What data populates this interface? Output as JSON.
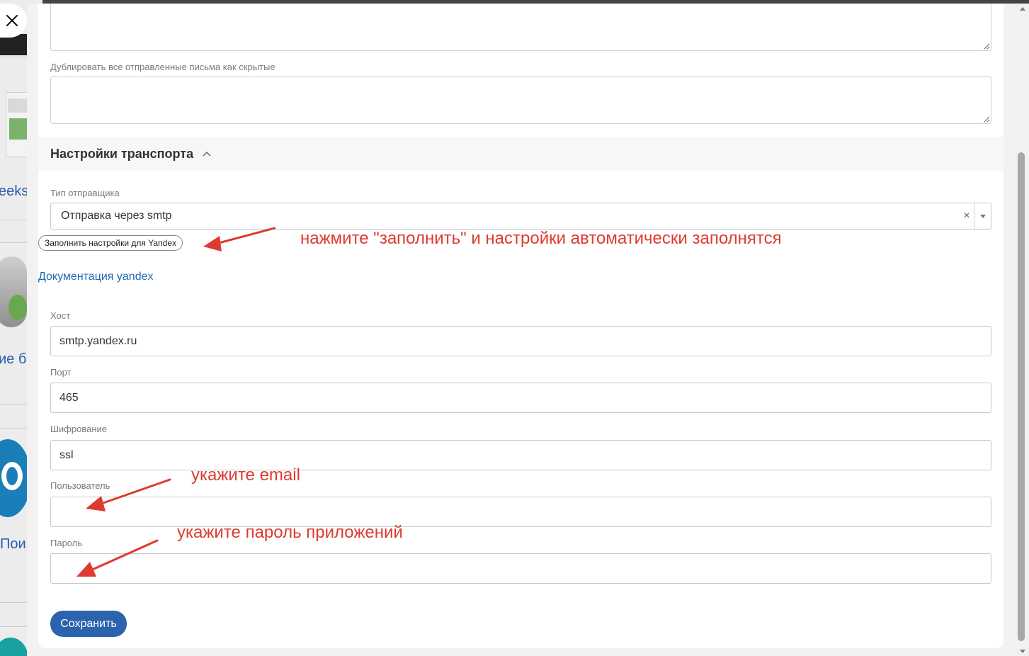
{
  "background": {
    "visible_words": [
      "eeks",
      "ие б",
      "Пои"
    ]
  },
  "modal": {
    "close_icon": "close-icon",
    "bcc_label": "Дублировать все отправленные письма как скрытые",
    "section": {
      "title": "Настройки транспорта",
      "toggle_icon": "chevron-up-icon"
    },
    "sender_type": {
      "label": "Тип отправщика",
      "value": "Отправка через smtp",
      "clear_glyph": "×"
    },
    "fill_button_label": "Заполнить настройки для Yandex",
    "docs_link": "Документация yandex",
    "fields": {
      "host": {
        "label": "Хост",
        "value": "smtp.yandex.ru"
      },
      "port": {
        "label": "Порт",
        "value": "465"
      },
      "encryption": {
        "label": "Шифрование",
        "value": "ssl"
      },
      "user": {
        "label": "Пользователь",
        "value": ""
      },
      "password": {
        "label": "Пароль",
        "value": ""
      }
    },
    "save_label": "Сохранить"
  },
  "annotations": {
    "fill_hint": "нажмите \"заполнить\" и настройки автоматически заполнятся",
    "email_hint": "укажите email",
    "password_hint": "укажите пароль приложений",
    "color": "#dd3b2f"
  },
  "colors": {
    "primary": "#2b63ad",
    "link": "#2469b4"
  }
}
